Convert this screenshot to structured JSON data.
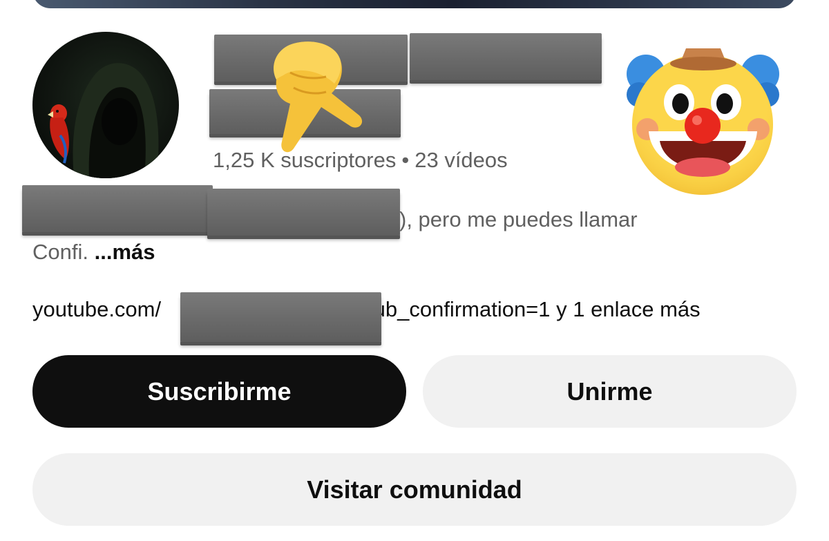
{
  "channel": {
    "subscribers": "1,25 K suscriptores",
    "separator": "•",
    "videos": "23 vídeos"
  },
  "description": {
    "line1_tail": "), pero me puedes llamar",
    "line2_text": "Confi.",
    "more_label": "...más"
  },
  "links": {
    "prefix": "youtube.com/",
    "suffix": "sub_confirmation=1 y 1 enlace más"
  },
  "buttons": {
    "subscribe": "Suscribirme",
    "join": "Unirme",
    "community": "Visitar comunidad"
  },
  "icons": {
    "pointing": "pointing-down-hand-icon",
    "clown": "clown-face-icon"
  },
  "colors": {
    "subscribe_bg": "#0f0f0f",
    "secondary_bg": "#f1f1f1",
    "muted_text": "#606060"
  }
}
